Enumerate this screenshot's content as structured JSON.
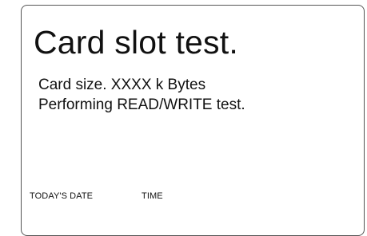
{
  "screen": {
    "title": "Card slot test.",
    "lines": [
      "Card size. XXXX k Bytes",
      "Performing READ/WRITE test."
    ],
    "footer": {
      "date_label": "TODAY'S DATE",
      "time_label": "TIME"
    }
  }
}
